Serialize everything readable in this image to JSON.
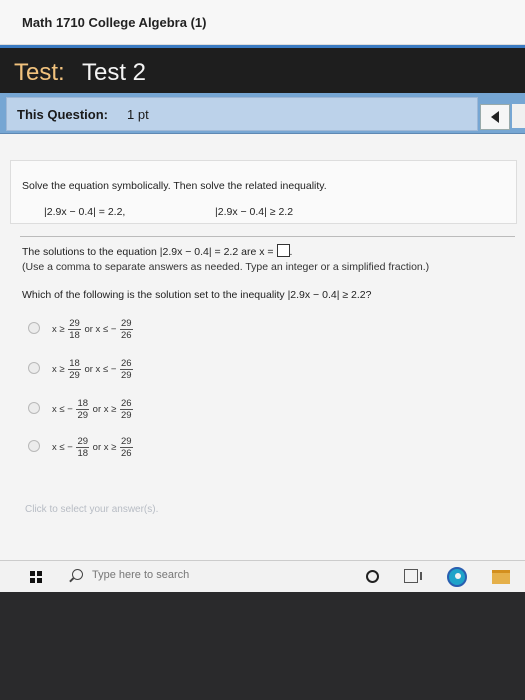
{
  "course": {
    "title": "Math 1710 College Algebra (1)"
  },
  "test": {
    "label": "Test:",
    "name": "Test 2"
  },
  "question": {
    "label": "This Question:",
    "points": "1 pt"
  },
  "problem": {
    "instructions": "Solve the equation symbolically. Then solve the related inequality.",
    "equation": "|2.9x − 0.4| = 2.2,",
    "inequality": "|2.9x − 0.4| ≥ 2.2",
    "answer_prompt": "The solutions to the equation |2.9x − 0.4| = 2.2 are x =",
    "answer_value": "",
    "answer_hint": "(Use a comma to separate answers as needed. Type an integer or a simplified fraction.)",
    "inequality_question": "Which of the following is the solution set to the inequality |2.9x − 0.4| ≥ 2.2?"
  },
  "options": [
    {
      "left_op": "x ≥",
      "left_sign": "",
      "left_num": "29",
      "left_den": "18",
      "joiner": "or x ≤",
      "right_sign": "−",
      "right_num": "29",
      "right_den": "26"
    },
    {
      "left_op": "x ≥",
      "left_sign": "",
      "left_num": "18",
      "left_den": "29",
      "joiner": "or x ≤",
      "right_sign": "−",
      "right_num": "26",
      "right_den": "29"
    },
    {
      "left_op": "x ≤",
      "left_sign": "−",
      "left_num": "18",
      "left_den": "29",
      "joiner": "or x ≥",
      "right_sign": "",
      "right_num": "26",
      "right_den": "29"
    },
    {
      "left_op": "x ≤",
      "left_sign": "−",
      "left_num": "29",
      "left_den": "18",
      "joiner": "or x ≥",
      "right_sign": "",
      "right_num": "29",
      "right_den": "26"
    }
  ],
  "footer": {
    "click_hint": "Click to select your answer(s)."
  },
  "taskbar": {
    "search_placeholder": "Type here to search"
  },
  "colors": {
    "accent_blue": "#76a6d3",
    "test_label_color": "#f1c27d"
  }
}
